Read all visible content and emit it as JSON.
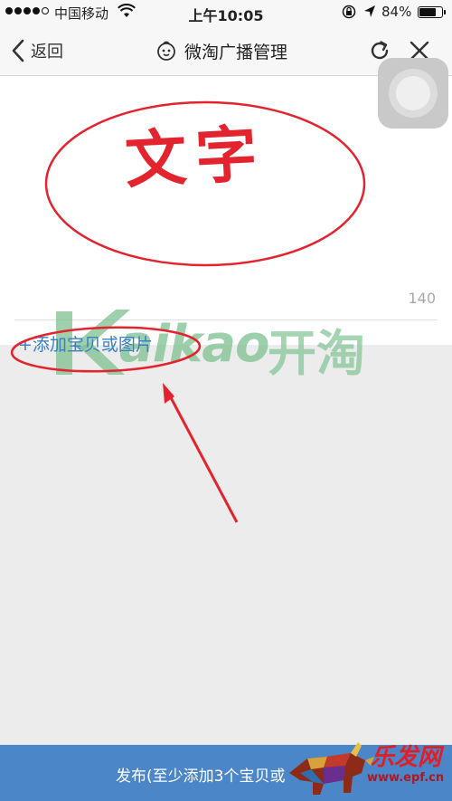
{
  "status_bar": {
    "carrier": "中国移动",
    "time": "上午10:05",
    "battery_percent": "84%",
    "battery_level": 0.84,
    "icons": [
      "signal-dots-icon",
      "wifi-icon",
      "rotation-lock-icon",
      "location-arrow-icon",
      "battery-icon"
    ]
  },
  "nav": {
    "back_label": "返回",
    "title": "微淘广播管理",
    "title_icon": "face-avatar-icon",
    "refresh_icon": "refresh-icon",
    "close_icon": "close-icon"
  },
  "editor": {
    "char_count": "140",
    "add_item_label": "+添加宝贝或图片"
  },
  "annotation": {
    "text": "文字",
    "color": "#e3232e"
  },
  "watermark": {
    "latin": "aikao",
    "chinese": "开淘",
    "color": "#7cc08f"
  },
  "publish": {
    "label": "发布(至少添加3个宝贝或",
    "bg_color": "#4a86c8"
  },
  "corner_logo": {
    "chinese": "乐发网",
    "url": "www.epf.cn"
  },
  "colors": {
    "accent": "#4a86c8",
    "link": "#3a7fc8",
    "page_bg": "#ececec"
  }
}
